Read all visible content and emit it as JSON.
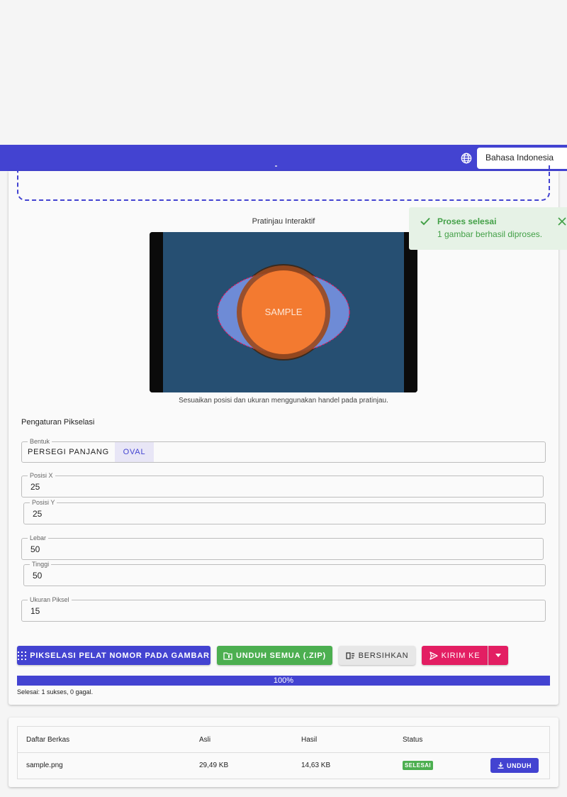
{
  "header": {
    "language": "Bahasa Indonesia",
    "icons": [
      "globe-icon"
    ]
  },
  "preview": {
    "title": "Pratinjau Interaktif",
    "sample_text": "SAMPLE",
    "hint": "Sesuaikan posisi dan ukuran menggunakan handel pada pratinjau."
  },
  "settings": {
    "title": "Pengaturan Pikselasi",
    "shape": {
      "label": "Bentuk",
      "options": [
        "PERSEGI PANJANG",
        "OVAL"
      ],
      "selected": "OVAL"
    },
    "pos_x": {
      "label": "Posisi X",
      "value": "25"
    },
    "pos_y": {
      "label": "Posisi Y",
      "value": "25"
    },
    "width": {
      "label": "Lebar",
      "value": "50"
    },
    "height": {
      "label": "Tinggi",
      "value": "50"
    },
    "pixel_size": {
      "label": "Ukuran Piksel",
      "value": "15"
    }
  },
  "actions": {
    "pixelate": "PIKSELASI PELAT NOMOR PADA GAMBAR",
    "download_all": "UNDUH SEMUA (.ZIP)",
    "clear": "BERSIHKAN",
    "send_to": "KIRIM KE"
  },
  "progress": {
    "percent": 100,
    "label": "100%",
    "status": "Selesai: 1 sukses, 0 gagal."
  },
  "files": {
    "headers": [
      "Daftar Berkas",
      "Asli",
      "Hasil",
      "Status"
    ],
    "rows": [
      {
        "name": "sample.png",
        "original": "29,49 KB",
        "result": "14,63 KB",
        "status": "SELESAI",
        "action": "UNDUH"
      }
    ]
  },
  "toast": {
    "title": "Proses selesai",
    "message": "1 gambar berhasil diproses."
  },
  "colors": {
    "primary": "#4343d1",
    "success": "#4caf50",
    "accent": "#e31e63",
    "preview_bg": "#264f72",
    "sample_circle": "#f37a30",
    "oval_overlay": "#6e8bd6"
  }
}
